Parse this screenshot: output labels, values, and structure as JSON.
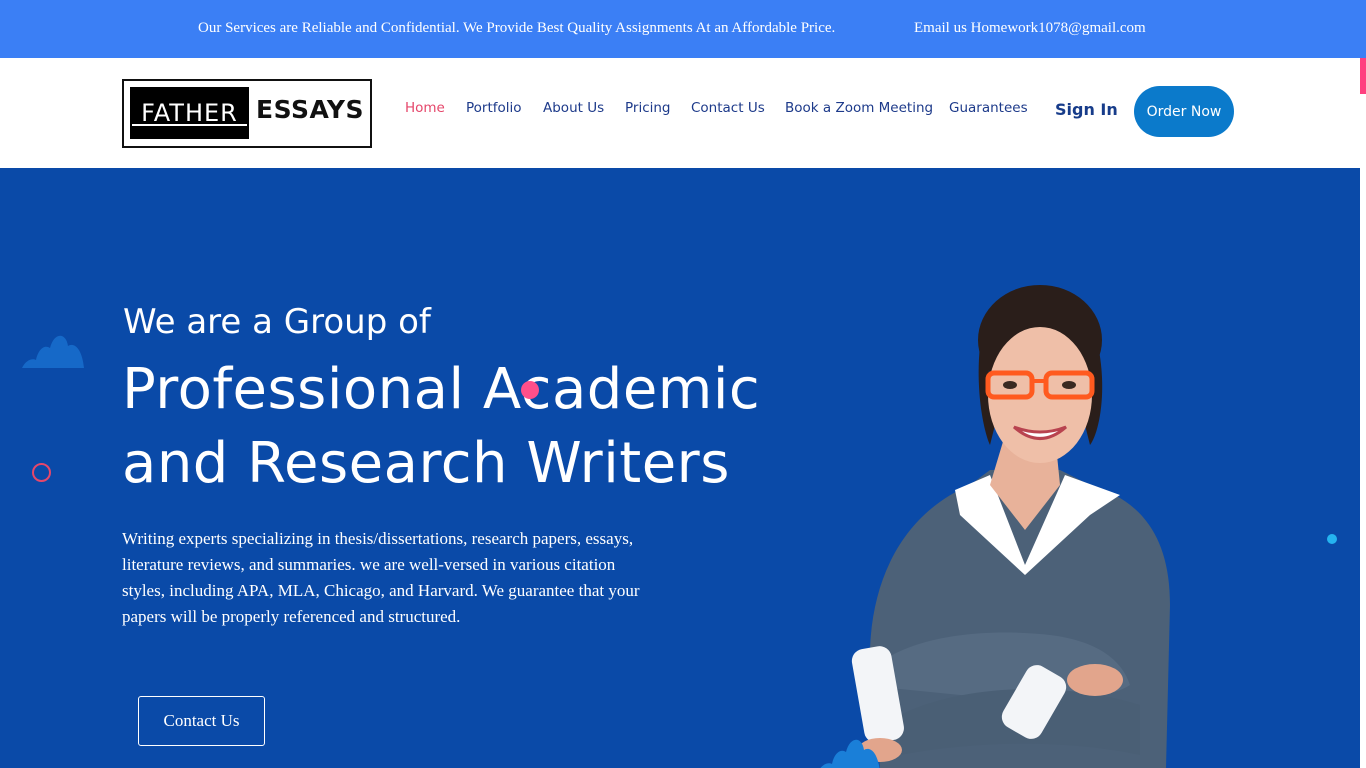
{
  "topbar": {
    "message": "Our Services are Reliable and Confidential. We Provide Best Quality Assignments At an Affordable Price.",
    "email": "Email us Homework1078@gmail.com"
  },
  "logo": {
    "word1": "FATHER",
    "word2": "ESSAYS"
  },
  "nav": {
    "items": [
      {
        "label": "Home",
        "active": true
      },
      {
        "label": "Portfolio"
      },
      {
        "label": "About Us"
      },
      {
        "label": "Pricing"
      },
      {
        "label": "Contact Us"
      },
      {
        "label": "Book a Zoom Meeting"
      },
      {
        "label": "Guarantees"
      }
    ],
    "sign_in": "Sign In",
    "order_now": "Order Now"
  },
  "hero": {
    "subtitle": "We are a Group of",
    "title_line1": "Professional Academic",
    "title_line2": "and Research Writers",
    "description": "Writing experts specializing in thesis/dissertations, research papers, essays, literature reviews, and summaries. we are well-versed in various citation styles, including APA, MLA, Chicago, and Harvard. We guarantee that your papers will be properly referenced and structured.",
    "cta_label": "Contact Us"
  },
  "colors": {
    "topbar": "#3b7ff5",
    "hero_bg": "#0a4aa8",
    "nav_text": "#1d3a8a",
    "nav_active": "#e5476b",
    "order_button": "#0b7acb",
    "accent_pink": "#ff4f8a",
    "accent_cyan": "#25b4f0"
  }
}
